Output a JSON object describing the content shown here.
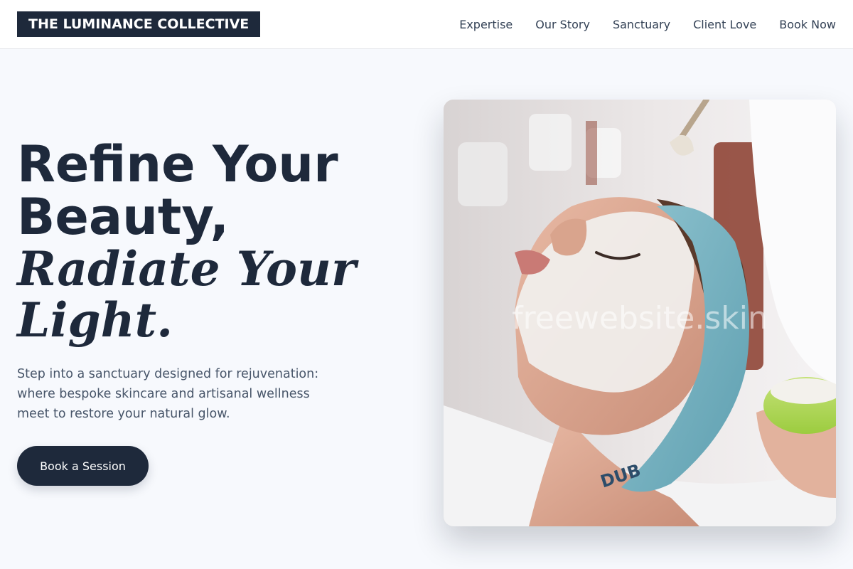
{
  "brand": {
    "name": "THE LUMINANCE COLLECTIVE"
  },
  "nav": {
    "items": [
      {
        "label": "Expertise"
      },
      {
        "label": "Our Story"
      },
      {
        "label": "Sanctuary"
      },
      {
        "label": "Client Love"
      },
      {
        "label": "Book Now"
      }
    ]
  },
  "hero": {
    "headline_line1": "Refine Your",
    "headline_line2": "Beauty,",
    "headline_italic1": "Radiate Your",
    "headline_italic2": "Light.",
    "description": "Step into a sanctuary designed for rejuvenation: where bespoke skincare and artisanal wellness meet to restore your natural glow.",
    "cta_label": "Book a Session",
    "image_watermark": "freewebsite.skin",
    "towel_text": "DUB"
  },
  "colors": {
    "primary": "#1e293b",
    "background": "#f7f9fd",
    "text_muted": "#475569",
    "nav_text": "#334155"
  }
}
